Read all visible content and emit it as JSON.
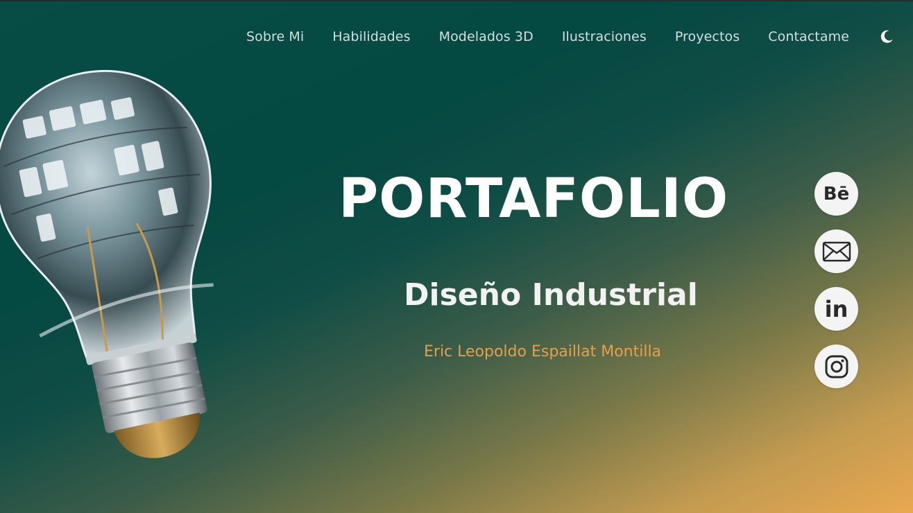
{
  "nav": {
    "links": [
      "Sobre Mi",
      "Habilidades",
      "Modelados 3D",
      "Ilustraciones",
      "Proyectos",
      "Contactame"
    ],
    "theme_toggle_icon": "moon-icon"
  },
  "hero": {
    "title": "PORTAFOLIO",
    "subtitle": "Diseño Industrial",
    "author": "Eric Leopoldo Espaillat Montilla",
    "image": "light-bulb"
  },
  "social": {
    "behance_label": "Bē",
    "linkedin_label": "in",
    "icons": [
      "behance-icon",
      "mail-icon",
      "linkedin-icon",
      "instagram-icon"
    ]
  },
  "colors": {
    "bg_top": "#044942",
    "bg_bottom": "#e9a850",
    "author_accent": "#e6a04a",
    "nav_text": "#d7dedb"
  }
}
